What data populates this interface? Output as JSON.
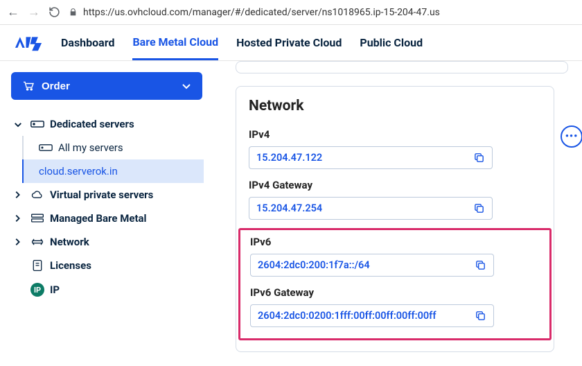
{
  "browser": {
    "url": "https://us.ovhcloud.com/manager/#/dedicated/server/ns1018965.ip-15-204-47.us"
  },
  "topnav": {
    "items": [
      "Dashboard",
      "Bare Metal Cloud",
      "Hosted Private Cloud",
      "Public Cloud"
    ],
    "activeIndex": 1
  },
  "sidebar": {
    "order_label": "Order",
    "tree": {
      "dedicated": {
        "label": "Dedicated servers",
        "all": "All my servers",
        "selected": "cloud.serverok.in"
      },
      "vps": "Virtual private servers",
      "mbm": "Managed Bare Metal",
      "network": "Network",
      "licenses": "Licenses",
      "ip": "IP"
    }
  },
  "main": {
    "panel_title": "Network",
    "fields": {
      "ipv4": {
        "label": "IPv4",
        "value": "15.204.47.122"
      },
      "ipv4gw": {
        "label": "IPv4 Gateway",
        "value": "15.204.47.254"
      },
      "ipv6": {
        "label": "IPv6",
        "value": "2604:2dc0:200:1f7a::/64"
      },
      "ipv6gw": {
        "label": "IPv6 Gateway",
        "value": "2604:2dc0:0200:1fff:00ff:00ff:00ff:00ff"
      }
    }
  }
}
